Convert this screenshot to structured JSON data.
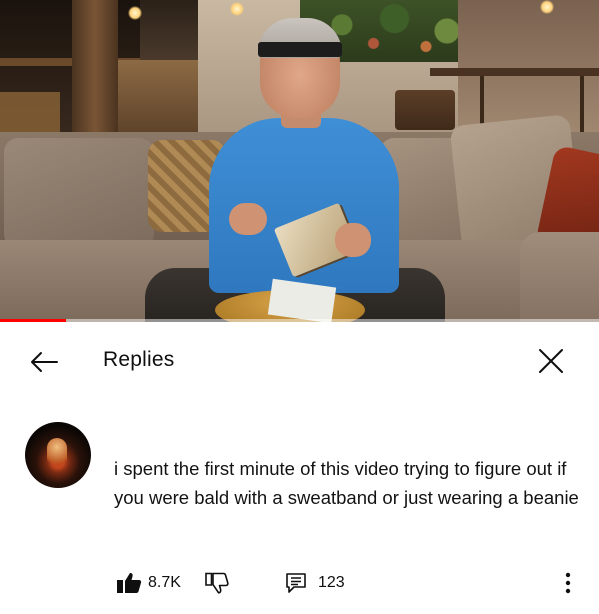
{
  "video": {
    "progress_fraction": 0.11
  },
  "header": {
    "back_icon": "arrow-left-icon",
    "title": "Replies",
    "close_icon": "close-icon"
  },
  "comment": {
    "avatar_icon": "user-avatar",
    "text": "i spent the first minute of this video trying to figure out if you were bald with a sweatband or just wearing a beanie",
    "likes": "8.7K",
    "replies": "123",
    "like_icon": "thumbs-up-filled-icon",
    "dislike_icon": "thumbs-down-icon",
    "reply_icon": "reply-icon",
    "more_icon": "more-vertical-icon"
  },
  "colors": {
    "progress": "#ff0000",
    "text": "#0f0f0f"
  }
}
